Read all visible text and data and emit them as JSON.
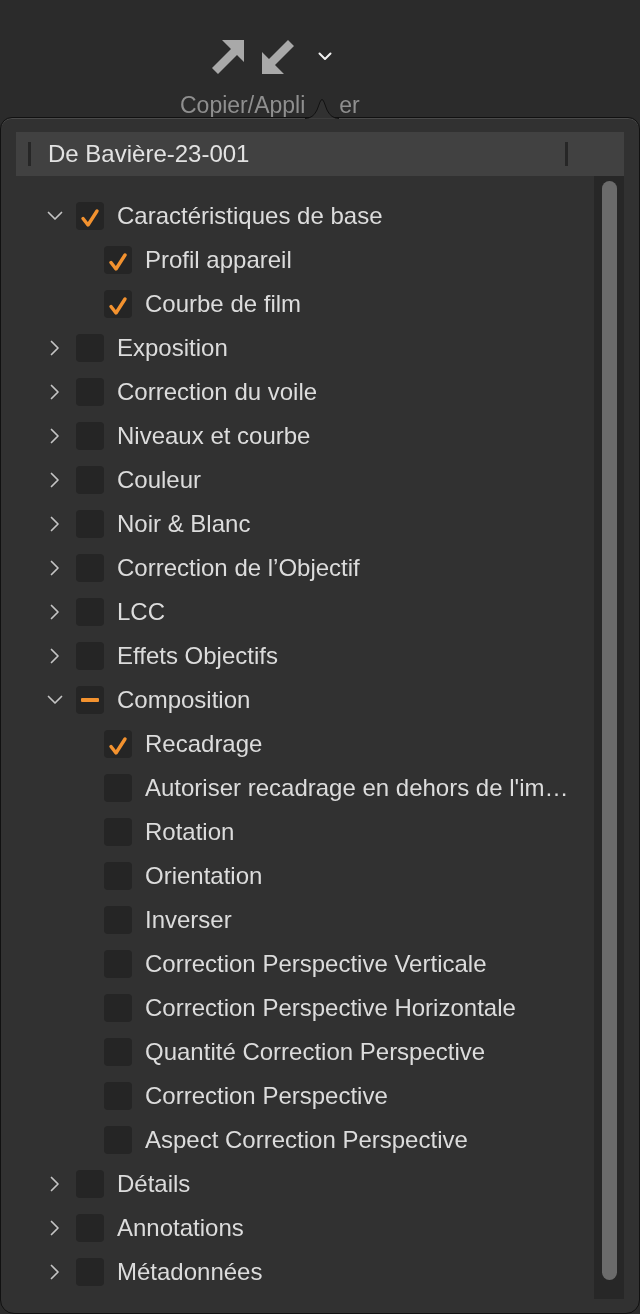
{
  "toolbar": {
    "label_parts": [
      "Copier/Appli",
      "er"
    ]
  },
  "popover": {
    "title": "De Bavière-23-001",
    "groups": [
      {
        "label": "Caractéristiques de base",
        "checked": true,
        "expanded": true,
        "children": [
          {
            "label": "Profil appareil",
            "checked": true
          },
          {
            "label": "Courbe de film",
            "checked": true
          }
        ]
      },
      {
        "label": "Exposition",
        "checked": false,
        "expanded": false
      },
      {
        "label": "Correction du voile",
        "checked": false,
        "expanded": false
      },
      {
        "label": "Niveaux et courbe",
        "checked": false,
        "expanded": false
      },
      {
        "label": "Couleur",
        "checked": false,
        "expanded": false
      },
      {
        "label": "Noir & Blanc",
        "checked": false,
        "expanded": false
      },
      {
        "label": "Correction de l’Objectif",
        "checked": false,
        "expanded": false
      },
      {
        "label": "LCC",
        "checked": false,
        "expanded": false
      },
      {
        "label": "Effets Objectifs",
        "checked": false,
        "expanded": false
      },
      {
        "label": "Composition",
        "checked": true,
        "partial": true,
        "expanded": true,
        "children": [
          {
            "label": "Recadrage",
            "checked": true
          },
          {
            "label": "Autoriser recadrage en dehors de l'im…",
            "checked": false
          },
          {
            "label": "Rotation",
            "checked": false
          },
          {
            "label": "Orientation",
            "checked": false
          },
          {
            "label": "Inverser",
            "checked": false
          },
          {
            "label": "Correction Perspective Verticale",
            "checked": false
          },
          {
            "label": "Correction Perspective Horizontale",
            "checked": false
          },
          {
            "label": "Quantité Correction Perspective",
            "checked": false
          },
          {
            "label": "Correction Perspective",
            "checked": false
          },
          {
            "label": "Aspect Correction Perspective",
            "checked": false
          }
        ]
      },
      {
        "label": "Détails",
        "checked": false,
        "expanded": false
      },
      {
        "label": "Annotations",
        "checked": false,
        "expanded": false
      },
      {
        "label": "Métadonnées",
        "checked": false,
        "expanded": false
      }
    ]
  }
}
